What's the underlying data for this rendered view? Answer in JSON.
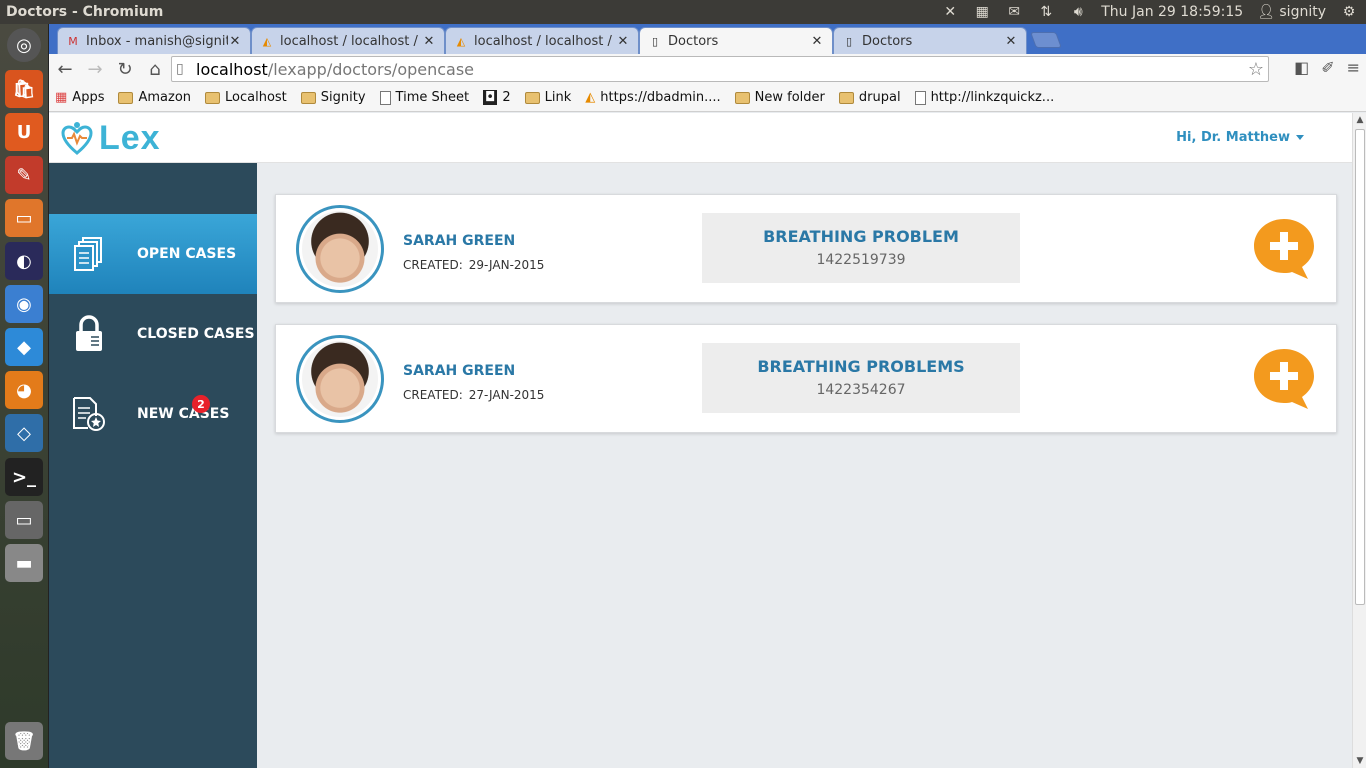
{
  "window": {
    "title": "Doctors - Chromium"
  },
  "tray": {
    "datetime": "Thu Jan 29 18:59:15",
    "user": "signity"
  },
  "tabs": [
    {
      "title": "Inbox - manish@signitysol",
      "icon": "gmail-icon",
      "active": false
    },
    {
      "title": "localhost / localhost / diag",
      "icon": "phpmyadmin-icon",
      "active": false
    },
    {
      "title": "localhost / localhost / diag",
      "icon": "phpmyadmin-icon",
      "active": false
    },
    {
      "title": "Doctors",
      "icon": "page-icon",
      "active": true
    },
    {
      "title": "Doctors",
      "icon": "page-icon",
      "active": false
    }
  ],
  "address": {
    "host": "localhost",
    "path": "/lexapp/doctors/opencase"
  },
  "bookmarks": [
    {
      "label": "Apps",
      "kind": "apps"
    },
    {
      "label": "Amazon",
      "kind": "folder"
    },
    {
      "label": "Localhost",
      "kind": "folder"
    },
    {
      "label": "Signity",
      "kind": "folder"
    },
    {
      "label": "Time Sheet",
      "kind": "page"
    },
    {
      "label": "2",
      "kind": "ext"
    },
    {
      "label": "Link",
      "kind": "folder"
    },
    {
      "label": "https://dbadmin....",
      "kind": "pma"
    },
    {
      "label": "New folder",
      "kind": "folder"
    },
    {
      "label": "drupal",
      "kind": "folder"
    },
    {
      "label": "http://linkzquickz...",
      "kind": "page"
    }
  ],
  "app": {
    "logo_text": "Lex",
    "user_greeting": "Hi, Dr. Matthew",
    "brand_color": "#3db3d6",
    "sidebar_color": "#2c4a5b",
    "accent_orange": "#f39a1e"
  },
  "sidebar": {
    "items": [
      {
        "label": "OPEN CASES",
        "icon": "documents-icon",
        "active": true
      },
      {
        "label": "CLOSED CASES",
        "icon": "lock-icon",
        "active": false
      },
      {
        "label": "NEW CASES",
        "icon": "new-case-icon",
        "active": false,
        "badge": "2"
      }
    ]
  },
  "cases": [
    {
      "patient": "SARAH GREEN",
      "created_label": "CREATED:",
      "created": "29-JAN-2015",
      "problem": "BREATHING PROBLEM",
      "case_id": "1422519739"
    },
    {
      "patient": "SARAH GREEN",
      "created_label": "CREATED:",
      "created": "27-JAN-2015",
      "problem": "BREATHING PROBLEMS",
      "case_id": "1422354267"
    }
  ]
}
